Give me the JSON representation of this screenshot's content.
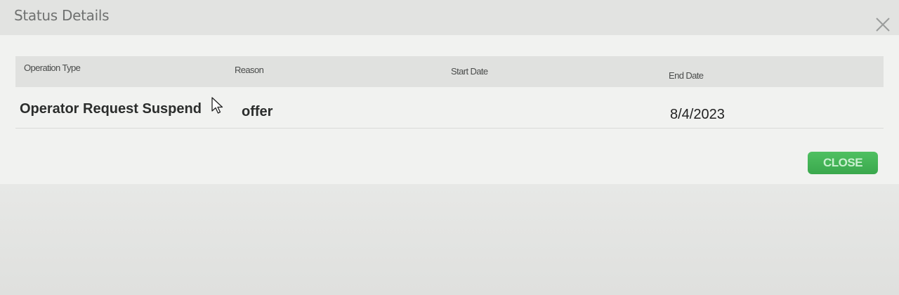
{
  "dialog": {
    "title": "Status Details",
    "close_icon": "close-icon"
  },
  "table": {
    "columns": [
      "Operation Type",
      "Reason",
      "Start Date",
      "End Date"
    ],
    "rows": [
      {
        "operation_type": "Operator Request Suspend",
        "reason": "offer",
        "start_date": "",
        "end_date": "8/4/2023"
      }
    ]
  },
  "footer": {
    "close_label": "CLOSE"
  },
  "colors": {
    "close_button": "#3fae52",
    "header_bg": "#e0e1df"
  }
}
